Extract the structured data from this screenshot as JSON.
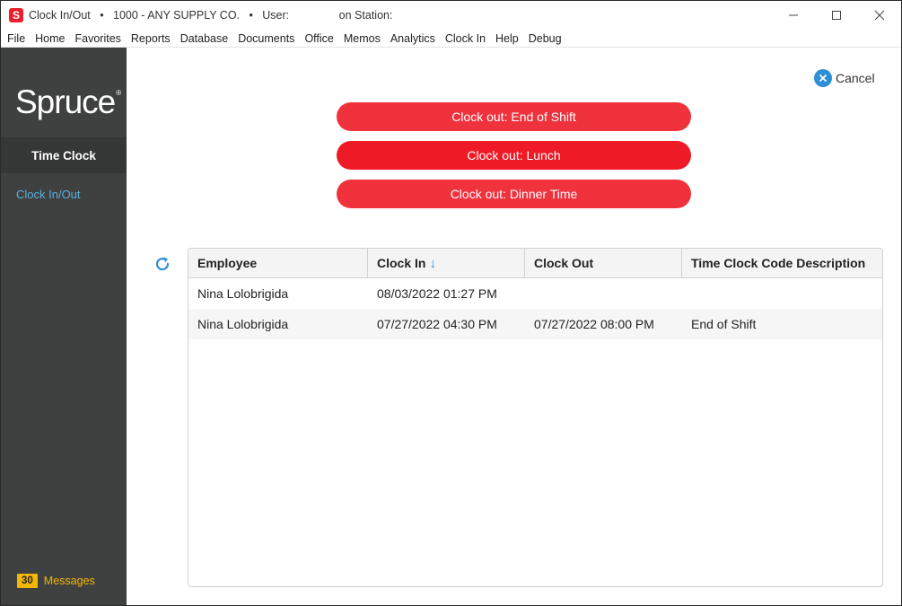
{
  "window": {
    "title": "Clock In/Out   •   1000 - ANY SUPPLY CO.   •   User:                on Station:",
    "app_icon_letter": "S"
  },
  "menu": [
    "File",
    "Home",
    "Favorites",
    "Reports",
    "Database",
    "Documents",
    "Office",
    "Memos",
    "Analytics",
    "Clock In",
    "Help",
    "Debug"
  ],
  "sidebar": {
    "logo": "Spruce",
    "logo_mark": "®",
    "section": "Time Clock",
    "link": "Clock In/Out",
    "messages_count": "30",
    "messages_label": "Messages"
  },
  "actions": {
    "cancel_label": "Cancel",
    "buttons": [
      "Clock out: End of Shift",
      "Clock out: Lunch",
      "Clock out: Dinner Time"
    ]
  },
  "table": {
    "columns": [
      "Employee",
      "Clock In",
      "Clock Out",
      "Time Clock Code Description"
    ],
    "sort_arrow": "↓",
    "rows": [
      [
        "Nina Lolobrigida",
        "08/03/2022 01:27 PM",
        "",
        ""
      ],
      [
        "Nina Lolobrigida",
        "07/27/2022 04:30 PM",
        "07/27/2022 08:00 PM",
        "End of Shift"
      ]
    ]
  },
  "colors": {
    "accent_red": "#f0323d",
    "accent_blue": "#2d8fd6",
    "sidebar_bg": "#3f4140",
    "messages_yellow": "#f2b705"
  }
}
